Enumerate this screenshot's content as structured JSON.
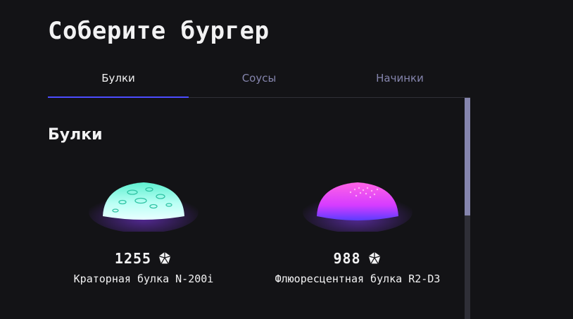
{
  "page": {
    "title": "Соберите бургер"
  },
  "tabs": [
    {
      "label": "Булки",
      "active": true
    },
    {
      "label": "Соусы",
      "active": false
    },
    {
      "label": "Начинки",
      "active": false
    }
  ],
  "section": {
    "title": "Булки"
  },
  "ingredients": [
    {
      "name": "Краторная булка N-200i",
      "price": "1255",
      "icon": "currency-icon",
      "color": "#aaffee"
    },
    {
      "name": "Флюоресцентная булка R2-D3",
      "price": "988",
      "icon": "currency-icon",
      "color": "#e84cff"
    }
  ],
  "colors": {
    "background": "#131316",
    "accent": "#4c4cff",
    "inactive_text": "#8585ad",
    "scrollbar_track": "#2f2f37",
    "scrollbar_thumb": "#8585ad"
  }
}
